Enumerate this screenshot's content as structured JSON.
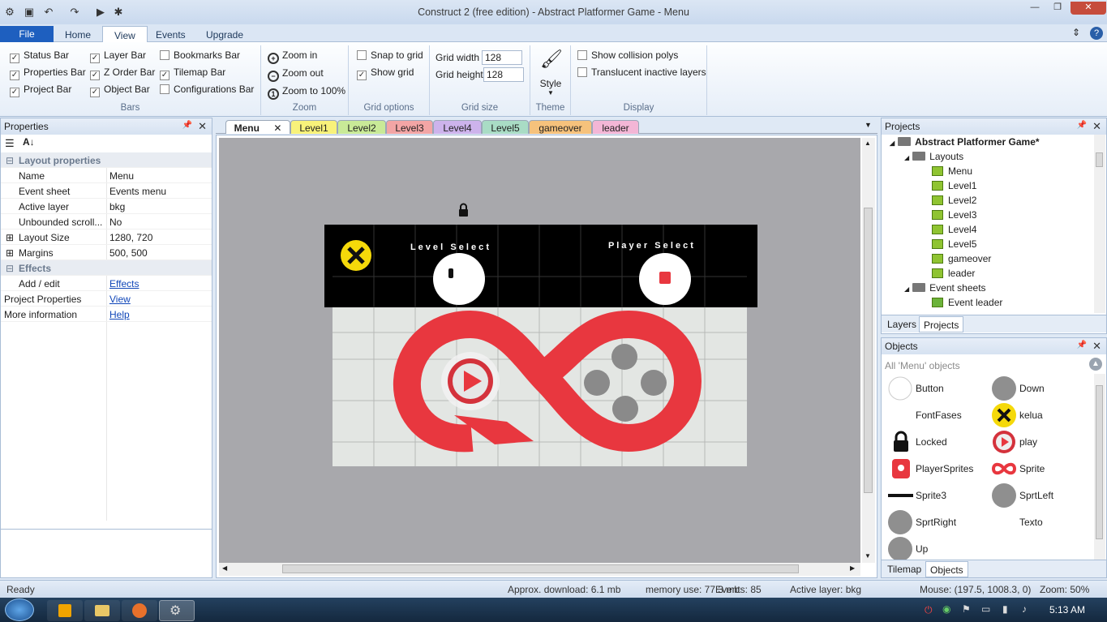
{
  "window": {
    "title": "Construct 2  (free edition) - Abstract Platformer Game - Menu"
  },
  "ribbon": {
    "tabs": [
      "File",
      "Home",
      "View",
      "Events",
      "Upgrade"
    ],
    "bars": {
      "items": [
        {
          "label": "Status Bar",
          "checked": true
        },
        {
          "label": "Properties Bar",
          "checked": true
        },
        {
          "label": "Project Bar",
          "checked": true
        },
        {
          "label": "Layer Bar",
          "checked": true
        },
        {
          "label": "Z Order Bar",
          "checked": true
        },
        {
          "label": "Object Bar",
          "checked": true
        },
        {
          "label": "Bookmarks Bar",
          "checked": false
        },
        {
          "label": "Tilemap Bar",
          "checked": true
        },
        {
          "label": "Configurations Bar",
          "checked": false
        }
      ],
      "group_label": "Bars"
    },
    "zoom": {
      "zoom_in": "Zoom in",
      "zoom_out": "Zoom out",
      "zoom_100": "Zoom to 100%",
      "group_label": "Zoom"
    },
    "grid_options": {
      "snap": "Snap to grid",
      "show": "Show grid",
      "group_label": "Grid options"
    },
    "grid_size": {
      "width_label": "Grid width",
      "width": "128",
      "height_label": "Grid height",
      "height": "128",
      "group_label": "Grid size"
    },
    "theme": {
      "style": "Style",
      "group_label": "Theme"
    },
    "display": {
      "collision": "Show collision polys",
      "translucent": "Translucent inactive layers",
      "group_label": "Display"
    }
  },
  "properties": {
    "title": "Properties",
    "sections": {
      "layout": "Layout properties",
      "effects": "Effects"
    },
    "rows": [
      {
        "k": "Name",
        "v": "Menu"
      },
      {
        "k": "Event sheet",
        "v": "Events menu"
      },
      {
        "k": "Active layer",
        "v": "bkg"
      },
      {
        "k": "Unbounded scroll...",
        "v": "No"
      },
      {
        "k": "Layout Size",
        "v": "1280, 720"
      },
      {
        "k": "Margins",
        "v": "500, 500"
      }
    ],
    "add_edit": "Add / edit",
    "effects_link": "Effects",
    "project_props": "Project Properties",
    "view_link": "View",
    "more_info": "More information",
    "help_link": "Help"
  },
  "layout_tabs": [
    "Menu",
    "Level1",
    "Level2",
    "Level3",
    "Level4",
    "Level5",
    "gameover",
    "leader"
  ],
  "canvas": {
    "level_select": "L e v e l   S e l e c t",
    "player_select": "P l a y e r   S e l e c t"
  },
  "projects": {
    "title": "Projects",
    "root": "Abstract Platformer Game*",
    "layouts_folder": "Layouts",
    "layouts": [
      "Menu",
      "Level1",
      "Level2",
      "Level3",
      "Level4",
      "Level5",
      "gameover",
      "leader"
    ],
    "events_folder": "Event sheets",
    "events": [
      "Event leader"
    ],
    "bottom_tabs": [
      "Layers",
      "Projects"
    ]
  },
  "objects": {
    "title": "Objects",
    "filter": "All 'Menu' objects",
    "items": [
      "Button",
      "Down",
      "FontFases",
      "kelua",
      "Locked",
      "play",
      "PlayerSprites",
      "Sprite",
      "Sprite3",
      "SprtLeft",
      "SprtRight",
      "Texto",
      "Up"
    ],
    "bottom_tabs": [
      "Tilemap",
      "Objects"
    ]
  },
  "status": {
    "ready": "Ready",
    "download": "Approx. download: 6.1 mb",
    "memory": "memory use: 77.3 mb",
    "events": "Events: 85",
    "layer": "Active layer: bkg",
    "mouse": "Mouse: (197.5, 1008.3, 0)",
    "zoom": "Zoom: 50%"
  },
  "taskbar": {
    "time": "5:13 AM"
  },
  "colors": {
    "accent": "#1e5fbf",
    "infinity": "#e8373f"
  }
}
